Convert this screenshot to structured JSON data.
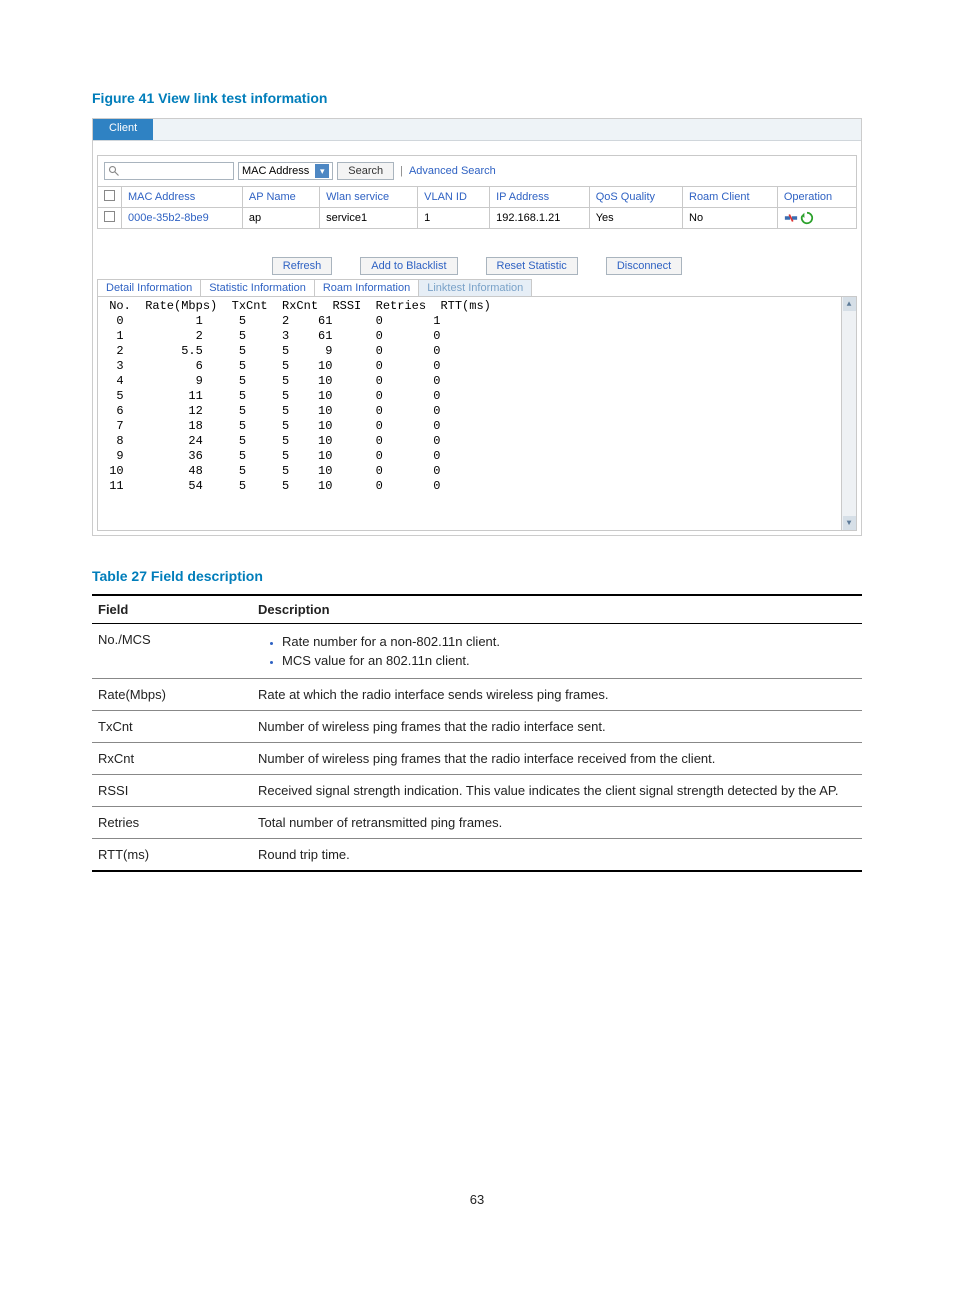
{
  "figure": {
    "caption": "Figure 41 View link test information",
    "tab_label": "Client",
    "search": {
      "placeholder": "",
      "dropdown_label": "MAC Address",
      "search_btn": "Search",
      "advanced_link": "Advanced Search"
    },
    "client_table": {
      "headers": [
        "",
        "MAC Address",
        "AP Name",
        "Wlan service",
        "VLAN ID",
        "IP Address",
        "QoS Quality",
        "Roam Client",
        "Operation"
      ],
      "rows": [
        {
          "mac": "000e-35b2-8be9",
          "ap": "ap",
          "wlan": "service1",
          "vlan": "1",
          "ip": "192.168.1.21",
          "qos": "Yes",
          "roam": "No"
        }
      ]
    },
    "action_buttons": [
      "Refresh",
      "Add to Blacklist",
      "Reset Statistic",
      "Disconnect"
    ],
    "info_tabs": [
      "Detail Information",
      "Statistic Information",
      "Roam Information",
      "Linktest Information"
    ],
    "linktest_header": " No.  Rate(Mbps)  TxCnt  RxCnt  RSSI  Retries  RTT(ms)",
    "linktest_data": [
      [
        0,
        "1",
        5,
        2,
        61,
        0,
        1
      ],
      [
        1,
        "2",
        5,
        3,
        61,
        0,
        0
      ],
      [
        2,
        "5.5",
        5,
        5,
        9,
        0,
        0
      ],
      [
        3,
        "6",
        5,
        5,
        10,
        0,
        0
      ],
      [
        4,
        "9",
        5,
        5,
        10,
        0,
        0
      ],
      [
        5,
        "11",
        5,
        5,
        10,
        0,
        0
      ],
      [
        6,
        "12",
        5,
        5,
        10,
        0,
        0
      ],
      [
        7,
        "18",
        5,
        5,
        10,
        0,
        0
      ],
      [
        8,
        "24",
        5,
        5,
        10,
        0,
        0
      ],
      [
        9,
        "36",
        5,
        5,
        10,
        0,
        0
      ],
      [
        10,
        "48",
        5,
        5,
        10,
        0,
        0
      ],
      [
        11,
        "54",
        5,
        5,
        10,
        0,
        0
      ]
    ]
  },
  "table27": {
    "caption": "Table 27 Field description",
    "headers": {
      "field": "Field",
      "desc": "Description"
    },
    "rows": [
      {
        "field": "No./MCS",
        "desc_list": [
          "Rate number for a non-802.11n client.",
          "MCS value for an 802.11n client."
        ]
      },
      {
        "field": "Rate(Mbps)",
        "desc": "Rate at which the radio interface sends wireless ping frames."
      },
      {
        "field": "TxCnt",
        "desc": "Number of wireless ping frames that the radio interface sent."
      },
      {
        "field": "RxCnt",
        "desc": "Number of wireless ping frames that the radio interface received from the client."
      },
      {
        "field": "RSSI",
        "desc": "Received signal strength indication. This value indicates the client signal strength detected by the AP."
      },
      {
        "field": "Retries",
        "desc": "Total number of retransmitted ping frames."
      },
      {
        "field": "RTT(ms)",
        "desc": "Round trip time."
      }
    ]
  },
  "page_number": "63"
}
